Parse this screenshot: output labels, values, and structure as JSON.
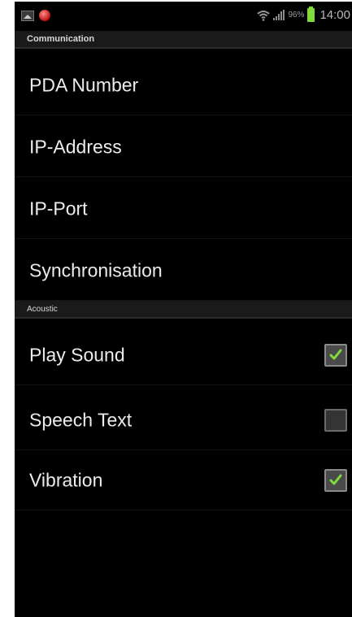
{
  "status_bar": {
    "battery_percent": "96%",
    "time": "14:00",
    "left_icons": [
      "image-icon",
      "app-red-icon"
    ],
    "right_icons": [
      "wifi-icon",
      "signal-icon",
      "battery-icon"
    ]
  },
  "sections": {
    "communication": {
      "header": "Communication",
      "items": [
        {
          "label": "PDA Number"
        },
        {
          "label": "IP-Address"
        },
        {
          "label": "IP-Port"
        },
        {
          "label": "Synchronisation"
        }
      ]
    },
    "acoustic": {
      "header": "Acoustic",
      "items": [
        {
          "label": "Play Sound",
          "checked": true
        },
        {
          "label": "Speech Text",
          "checked": false
        },
        {
          "label": "Vibration",
          "checked": true
        }
      ]
    }
  },
  "colors": {
    "background": "#000000",
    "check_accent": "#7fdc3a",
    "text": "#ececec"
  }
}
